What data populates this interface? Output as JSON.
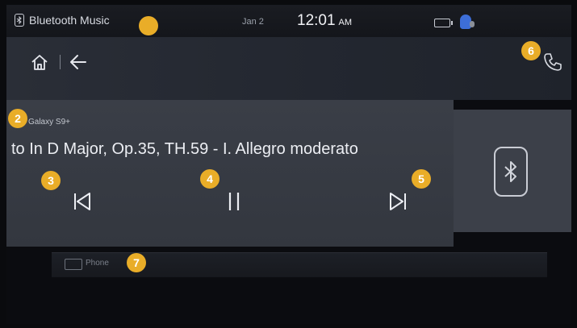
{
  "statusbar": {
    "source_label": "Bluetooth Music",
    "date": "Jan 2",
    "time": "12:01",
    "ampm": "AM"
  },
  "nav": {
    "home_icon": "home-icon",
    "back_icon": "back-arrow-icon",
    "phone_icon": "phone-icon"
  },
  "player": {
    "device_name": "Galaxy S9+",
    "track_title": "to In D Major, Op.35, TH.59 - I. Allegro moderato",
    "controls": [
      "previous-track-icon",
      "pause-icon",
      "next-track-icon"
    ],
    "album_art_icon": "bluetooth-icon"
  },
  "strip": {
    "label": "Phone"
  },
  "markers": {
    "m2": "2",
    "m3": "3",
    "m4": "4",
    "m5": "5",
    "m6": "6",
    "m7": "7"
  },
  "colors": {
    "marker": "#e9ad28",
    "panel": "#373b43",
    "background": "#0b0c10"
  }
}
